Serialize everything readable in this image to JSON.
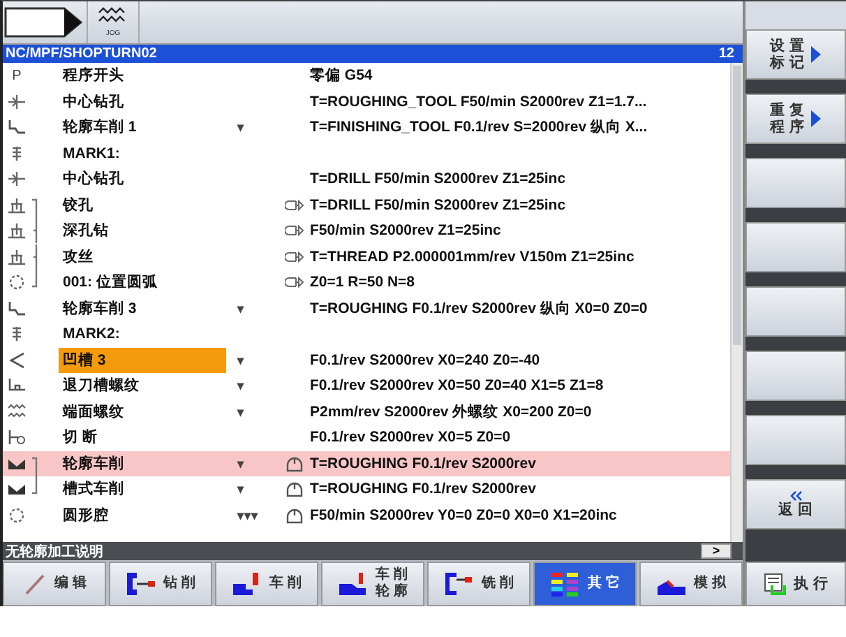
{
  "top_bar": {
    "jog_label": "JOG"
  },
  "header": {
    "path": "NC/MPF/SHOPTURN02",
    "count": "12"
  },
  "rows": [
    {
      "kind": "program",
      "icon_char": "P",
      "name": "程序开头",
      "params": "零偏 G54",
      "selected": false,
      "highlighted": false
    },
    {
      "kind": "center_drill",
      "name": "中心钻孔",
      "params": "T=ROUGHING_TOOL F50/min S2000rev Z1=1.7...",
      "selected": false,
      "highlighted": false
    },
    {
      "kind": "contour_turn",
      "name": "轮廓车削 1",
      "arrows": "▾",
      "params": "T=FINISHING_TOOL F0.1/rev S=2000rev 纵向 X...",
      "selected": false,
      "highlighted": false
    },
    {
      "kind": "mark",
      "name": "MARK1:",
      "selected": false,
      "highlighted": false
    },
    {
      "kind": "center_drill",
      "name": "中心钻孔",
      "params": "T=DRILL F50/min S2000rev Z1=25inc",
      "selected": false,
      "highlighted": false
    },
    {
      "kind": "drill",
      "chain": {
        "kind": "start"
      },
      "link": {
        "kind": "position"
      },
      "name": "铰孔",
      "params": "T=DRILL F50/min S2000rev Z1=25inc",
      "selected": false,
      "highlighted": false
    },
    {
      "kind": "drill",
      "chain": {
        "kind": "mid"
      },
      "link": {
        "kind": "position"
      },
      "name": "深孔钻",
      "params": "F50/min S2000rev Z1=25inc",
      "selected": false,
      "highlighted": false
    },
    {
      "kind": "drill",
      "chain": {
        "kind": "mid"
      },
      "link": {
        "kind": "position"
      },
      "name": "攻丝",
      "params": "T=THREAD P2.000001mm/rev V150m Z1=25inc",
      "selected": false,
      "highlighted": false
    },
    {
      "kind": "circle",
      "chain": {
        "kind": "end"
      },
      "link": {
        "kind": "position"
      },
      "name": "001: 位置圆弧",
      "params": "Z0=1 R=50 N=8",
      "selected": false,
      "highlighted": false
    },
    {
      "kind": "contour_turn",
      "name": "轮廓车削 3",
      "arrows": "▾",
      "params": "T=ROUGHING F0.1/rev S2000rev 纵向 X0=0 Z0=0",
      "selected": false,
      "highlighted": false
    },
    {
      "kind": "mark",
      "name": "MARK2:",
      "selected": false,
      "highlighted": false
    },
    {
      "kind": "groove",
      "name": "凹槽 3",
      "arrows": "▾",
      "params": "F0.1/rev S2000rev X0=240 Z0=-40",
      "selected": true,
      "highlighted": false
    },
    {
      "kind": "undercut",
      "name": "退刀槽螺纹",
      "arrows": "▾",
      "params": "F0.1/rev S2000rev X0=50 Z0=40 X1=5 Z1=8",
      "selected": false,
      "highlighted": false
    },
    {
      "kind": "thread",
      "name": "端面螺纹",
      "arrows": "▾",
      "params": "P2mm/rev S2000rev 外螺纹 X0=200 Z0=0",
      "selected": false,
      "highlighted": false
    },
    {
      "kind": "parting",
      "name": "切 断",
      "params": "F0.1/rev S2000rev X0=5 Z0=0",
      "selected": false,
      "highlighted": false
    },
    {
      "kind": "pocket",
      "chain": {
        "kind": "start"
      },
      "link": {
        "kind": "contour"
      },
      "name": "轮廓车削",
      "arrows": "▾",
      "params": "T=ROUGHING F0.1/rev S2000rev",
      "selected": false,
      "highlighted": true
    },
    {
      "kind": "pocket",
      "chain": {
        "kind": "end"
      },
      "link": {
        "kind": "contour"
      },
      "name": "槽式车削",
      "arrows": "▾",
      "params": "T=ROUGHING F0.1/rev S2000rev",
      "selected": false,
      "highlighted": false
    },
    {
      "kind": "circle",
      "link": {
        "kind": "contour"
      },
      "name": "圆形腔",
      "arrows": "▾▾▾",
      "params": "F50/min S2000rev Y0=0 Z0=0 X0=0 X1=20inc",
      "selected": false,
      "highlighted": false
    }
  ],
  "status_line": {
    "text": "无轮廓加工说明",
    "button": ">"
  },
  "side_softkeys": [
    {
      "kind": "menu",
      "lines": [
        "设 置",
        "标 记"
      ]
    },
    {
      "kind": "menu",
      "lines": [
        "重 复",
        "程 序"
      ]
    },
    {
      "kind": "blank"
    },
    {
      "kind": "blank"
    },
    {
      "kind": "blank"
    },
    {
      "kind": "blank"
    },
    {
      "kind": "blank"
    },
    {
      "kind": "back",
      "lines": [
        "返 回"
      ]
    }
  ],
  "bottom_softkeys": [
    {
      "kind": "edit",
      "lines": [
        "编 辑"
      ],
      "selected": false
    },
    {
      "kind": "drill",
      "lines": [
        "钻 削"
      ],
      "selected": false
    },
    {
      "kind": "turn",
      "lines": [
        "车 削"
      ],
      "selected": false
    },
    {
      "kind": "contour",
      "lines": [
        "车 削",
        "轮 廓"
      ],
      "selected": false
    },
    {
      "kind": "mill",
      "lines": [
        "铣 削"
      ],
      "selected": false
    },
    {
      "kind": "other",
      "lines": [
        "其 它"
      ],
      "selected": true
    },
    {
      "kind": "simulate",
      "lines": [
        "模 拟"
      ],
      "selected": false
    }
  ],
  "execute_softkey": {
    "lines": [
      "执 行"
    ]
  }
}
